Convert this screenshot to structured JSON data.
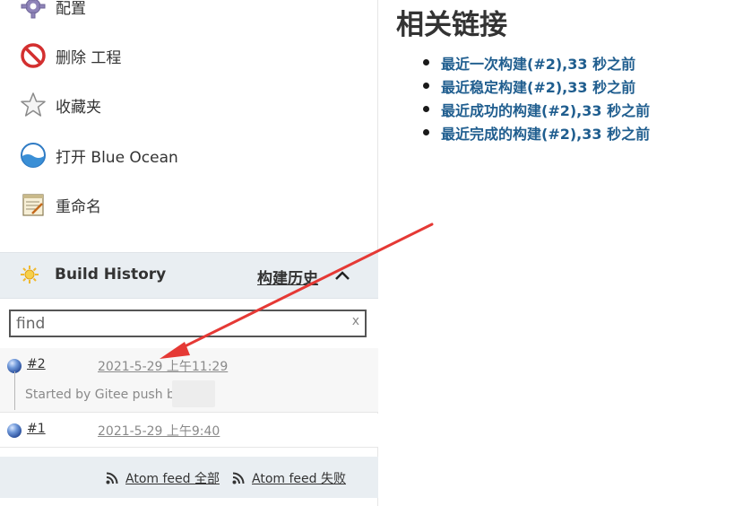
{
  "sidebar": {
    "tasks": [
      {
        "label": "配置",
        "icon": "gear-icon"
      },
      {
        "label": "删除 工程",
        "icon": "no-entry-icon"
      },
      {
        "label": "收藏夹",
        "icon": "star-icon"
      },
      {
        "label": "打开 Blue Ocean",
        "icon": "blue-ocean-icon"
      },
      {
        "label": "重命名",
        "icon": "notepad-icon"
      }
    ]
  },
  "build_history": {
    "title": "Build History",
    "trend_link": "构建历史",
    "search": {
      "value": "",
      "placeholder": "find",
      "clear_label": "x"
    },
    "builds": [
      {
        "number": "#2",
        "date": "2021-5-29 上午11:29",
        "description": "Started by Gitee push by",
        "status_color": "#4b77c4"
      },
      {
        "number": "#1",
        "date": "2021-5-29 上午9:40",
        "status_color": "#4b77c4"
      }
    ],
    "feeds": {
      "all": "Atom feed 全部",
      "failures": "Atom feed 失败"
    }
  },
  "main": {
    "title": "相关链接",
    "links": [
      "最近一次构建(#2),33 秒之前",
      "最近稳定构建(#2),33 秒之前",
      "最近成功的构建(#2),33 秒之前",
      "最近完成的构建(#2),33 秒之前"
    ]
  },
  "colors": {
    "link": "#205e8f",
    "widget_header_bg": "#e9eef2",
    "annotation_arrow": "#e53935"
  }
}
